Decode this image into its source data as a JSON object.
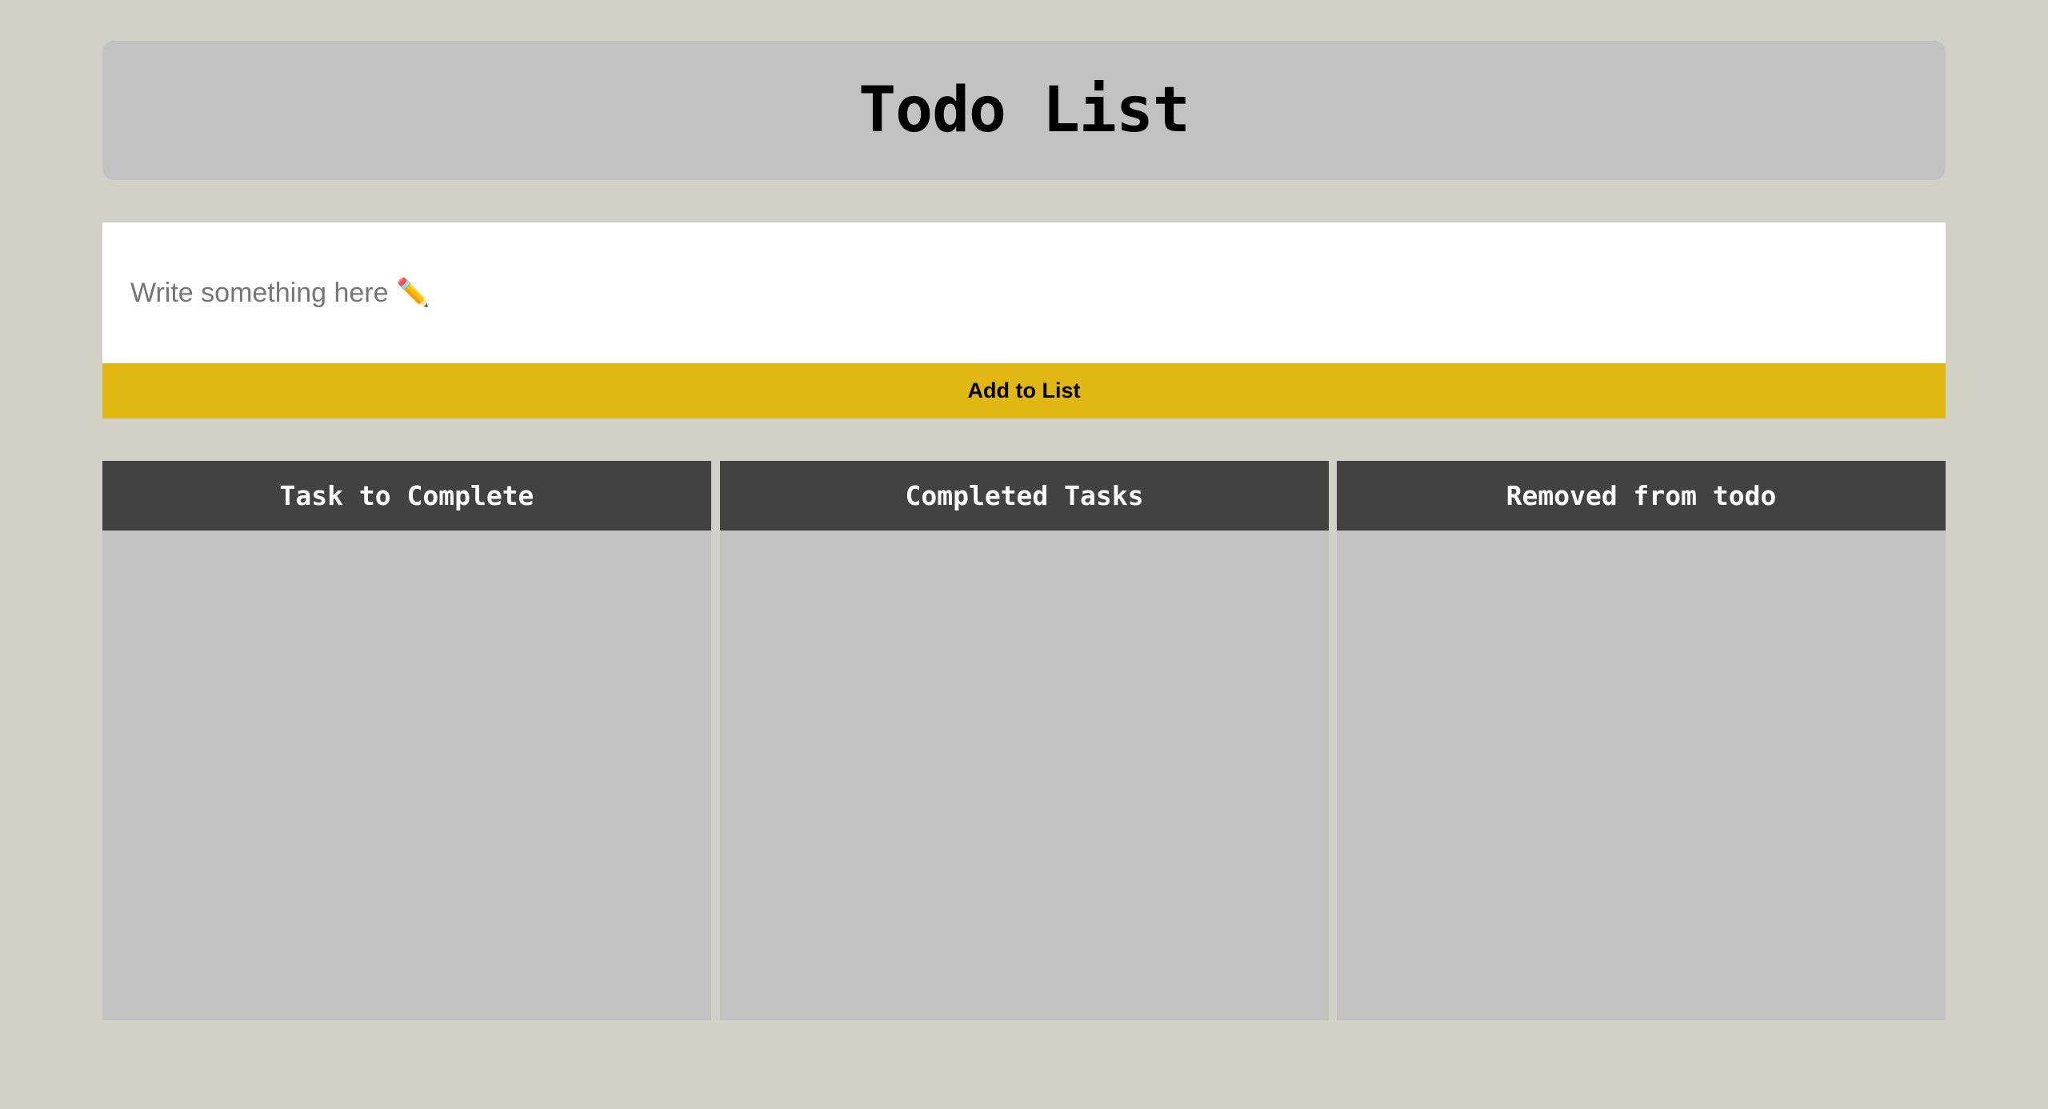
{
  "header": {
    "title": "Todo List"
  },
  "input": {
    "placeholder": "Write something here ✏️",
    "value": ""
  },
  "button": {
    "label": "Add to List",
    "color": "#e1b714"
  },
  "columns": [
    {
      "title": "Task to Complete",
      "items": []
    },
    {
      "title": "Completed Tasks",
      "items": []
    },
    {
      "title": "Removed from todo",
      "items": []
    }
  ],
  "colors": {
    "background": "#d1d1c5",
    "panel": "#c2c2c2",
    "column_header": "#424242"
  }
}
